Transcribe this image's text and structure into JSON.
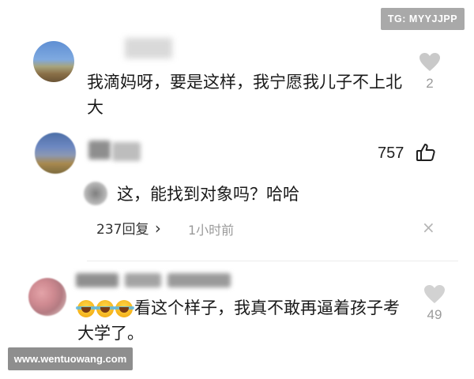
{
  "overlay": {
    "tg_badge": "TG: MYYJJPP",
    "watermark": "www.wentuowang.com"
  },
  "comments": [
    {
      "text": "我滴妈呀，要是这样，我宁愿我儿子不上北大",
      "like_count": "2",
      "like_icon": "heart-icon"
    },
    {
      "like_count": "757",
      "like_icon": "thumbs-up-icon",
      "reply": {
        "text": "这，能找到对象吗？哈哈"
      },
      "reply_count_label": "237回复",
      "reply_chevron": "›",
      "time": "1小时前",
      "close_symbol": "×"
    },
    {
      "text": "看这个样子，我真不敢再逼着孩子考大学了。",
      "emojis": [
        "laugh-cry-emoji",
        "laugh-cry-emoji",
        "laugh-cry-emoji"
      ],
      "like_count": "49",
      "like_icon": "heart-icon"
    }
  ],
  "colors": {
    "badge_bg": "#a9a9a9",
    "watermark_bg": "#8e8e8e",
    "muted_text": "#9a9a9a"
  }
}
